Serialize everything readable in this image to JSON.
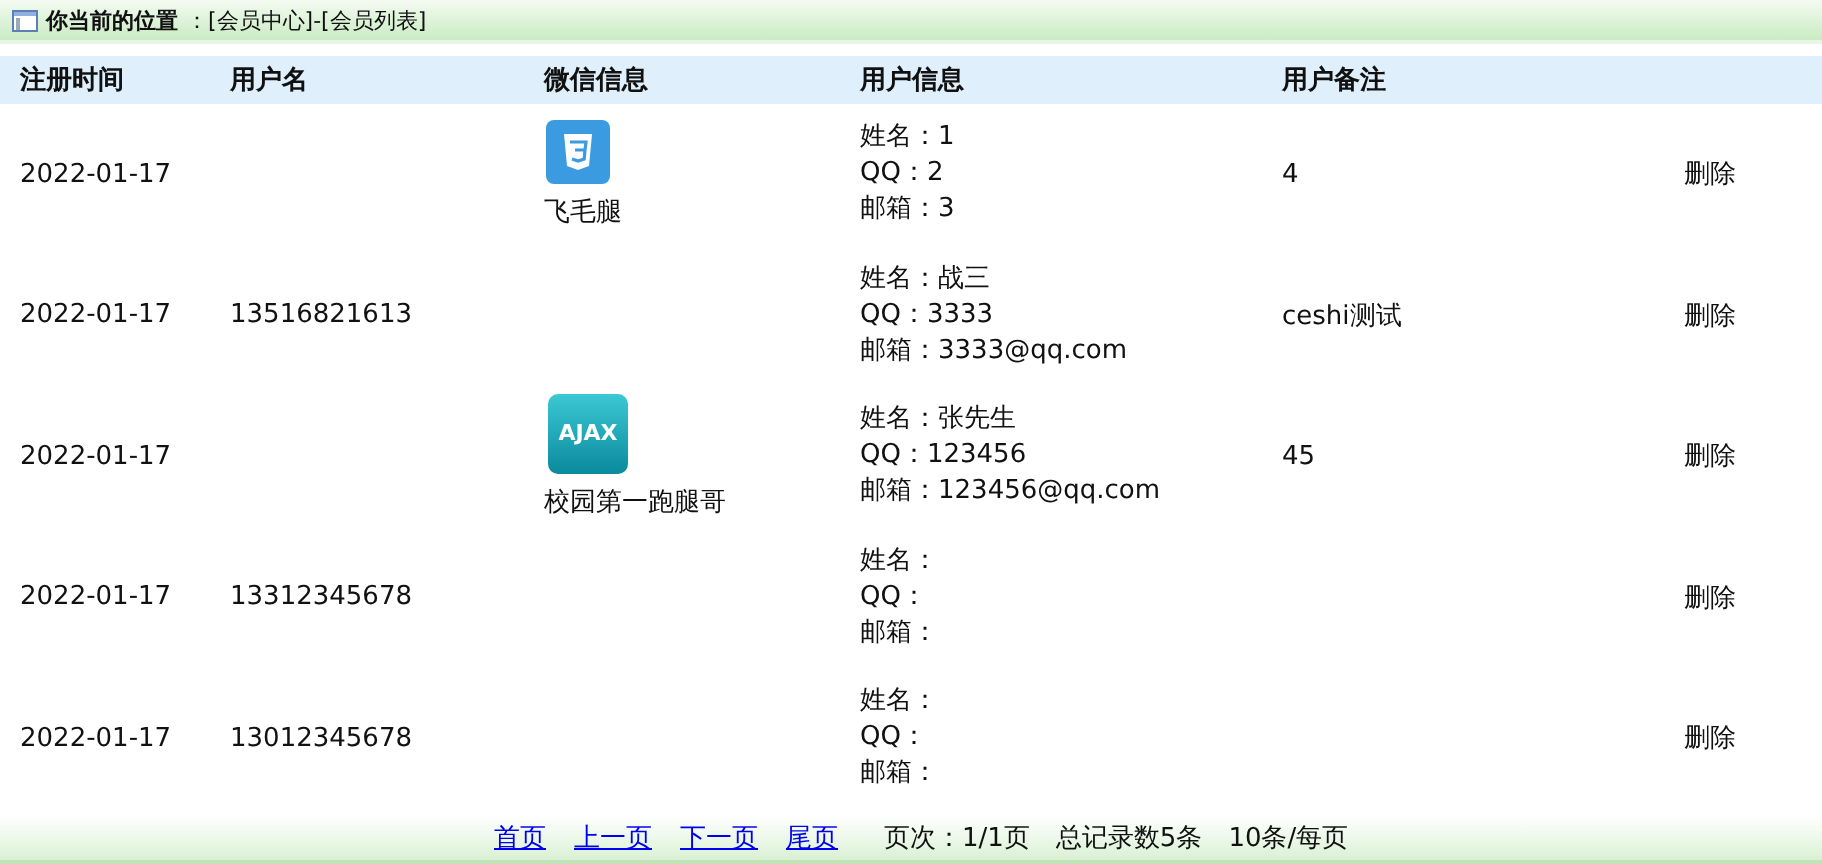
{
  "breadcrumb": {
    "label": "你当前的位置",
    "path": "：[会员中心]-[会员列表]"
  },
  "table": {
    "columns": [
      "注册时间",
      "用户名",
      "微信信息",
      "用户信息",
      "用户备注"
    ],
    "rows": [
      {
        "date": "2022-01-17",
        "username": "",
        "wechat": {
          "avatar": {
            "kind": "css"
          },
          "nickname": "飞毛腿"
        },
        "info": [
          "姓名：1",
          "QQ：2",
          "邮箱：3"
        ],
        "remark": "4",
        "action": "删除"
      },
      {
        "date": "2022-01-17",
        "username": "13516821613",
        "info": [
          "姓名：战三",
          "QQ：3333",
          "邮箱：3333@qq.com"
        ],
        "remark": "ceshi测试",
        "action": "删除"
      },
      {
        "date": "2022-01-17",
        "username": "",
        "wechat": {
          "avatar": {
            "kind": "ajax",
            "text": "AJAX"
          },
          "nickname": "校园第一跑腿哥"
        },
        "info": [
          "姓名：张先生",
          "QQ：123456",
          "邮箱：123456@qq.com"
        ],
        "remark": "45",
        "action": "删除"
      },
      {
        "date": "2022-01-17",
        "username": "13312345678",
        "info": [
          "姓名：",
          "QQ：",
          "邮箱："
        ],
        "remark": "",
        "action": "删除"
      },
      {
        "date": "2022-01-17",
        "username": "13012345678",
        "info": [
          "姓名：",
          "QQ：",
          "邮箱："
        ],
        "remark": "",
        "action": "删除"
      }
    ]
  },
  "pagination": {
    "links": [
      "首页",
      "上一页",
      "下一页",
      "尾页"
    ],
    "page": "页次：1/1页",
    "total": "总记录数5条",
    "per_page": "10条/每页"
  }
}
